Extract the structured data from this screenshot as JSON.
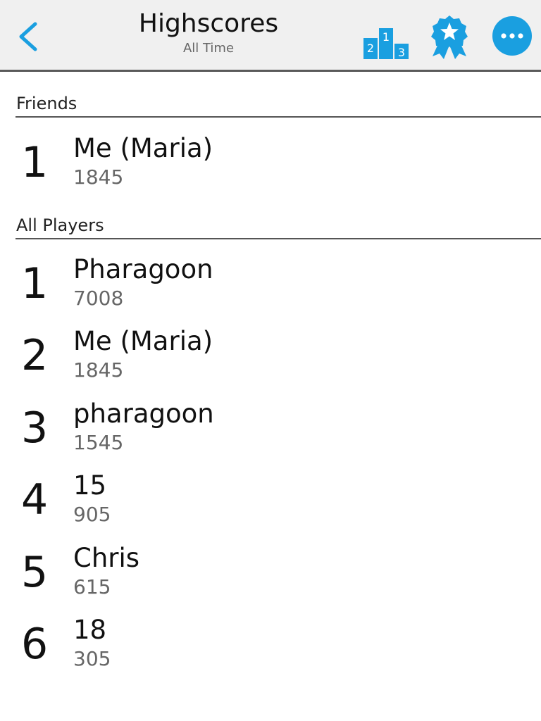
{
  "header": {
    "title": "Highscores",
    "subtitle": "All Time",
    "back_icon": "chevron-left-icon",
    "podium_icon": "podium-icon",
    "podium_numbers": [
      "2",
      "1",
      "3"
    ],
    "achievements_icon": "ribbon-star-icon",
    "more_icon": "more-horizontal-icon",
    "accent_color": "#1a9fe0"
  },
  "friends": {
    "label": "Friends",
    "entries": [
      {
        "rank": "1",
        "name": "Me (Maria)",
        "score": "1845"
      }
    ]
  },
  "all_players": {
    "label": "All Players",
    "entries": [
      {
        "rank": "1",
        "name": "Pharagoon",
        "score": "7008"
      },
      {
        "rank": "2",
        "name": "Me (Maria)",
        "score": "1845"
      },
      {
        "rank": "3",
        "name": "pharagoon",
        "score": "1545"
      },
      {
        "rank": "4",
        "name": "15",
        "score": "905"
      },
      {
        "rank": "5",
        "name": "Chris",
        "score": "615"
      },
      {
        "rank": "6",
        "name": "18",
        "score": "305"
      }
    ]
  }
}
